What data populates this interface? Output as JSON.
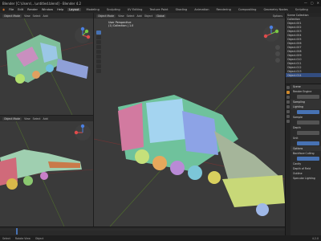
{
  "titlebar": {
    "title": "Blender [C:\\Users\\...\\untitled.blend] - Blender 4.2",
    "buttons": [
      "—",
      "▢",
      "✕"
    ]
  },
  "menubar": {
    "menus": [
      "File",
      "Edit",
      "Render",
      "Window",
      "Help"
    ],
    "workspaces": [
      "Layout",
      "Modeling",
      "Sculpting",
      "UV Editing",
      "Texture Paint",
      "Shading",
      "Animation",
      "Rendering",
      "Compositing",
      "Geometry Nodes",
      "Scripting"
    ],
    "active_workspace": "Layout"
  },
  "viewports": {
    "top_left": {
      "mode": "Object Mode",
      "menus": [
        "View",
        "Select",
        "Add",
        "Object"
      ]
    },
    "bottom_left": {
      "mode": "Object Mode",
      "menus": [
        "View",
        "Select",
        "Add",
        "Object"
      ]
    },
    "main": {
      "mode": "Object Mode",
      "menus": [
        "View",
        "Select",
        "Add",
        "Object"
      ],
      "transform": "Global",
      "info_line1": "User Perspective",
      "info_line2": "(1) Collection | 1.0",
      "options": "Options"
    }
  },
  "outliner": {
    "header": "Scene Collection",
    "rows": [
      "Scene Collection",
      "Collection",
      "Object.001",
      "Object.002",
      "Object.003",
      "Object.004",
      "Object.005",
      "Object.006",
      "Object.007",
      "Object.008",
      "Object.009",
      "Object.010",
      "Object.011",
      "Object.012",
      "Object.013",
      "Object.014"
    ]
  },
  "properties": {
    "sections": [
      "Scene",
      "Render Engine",
      "Sampling",
      "Lighting",
      "Sample",
      "Depth",
      "Unit",
      "Options",
      "Backface Culling",
      "Cavity",
      "Depth of Field",
      "Outline",
      "Specular Lighting"
    ]
  },
  "statusbar": {
    "items": [
      "Select",
      "Rotate View",
      "Object",
      "4.2.0"
    ]
  },
  "colors": {
    "accent": "#4772b3",
    "bg": "#3a3a3a",
    "panel": "#2b2b2b"
  }
}
